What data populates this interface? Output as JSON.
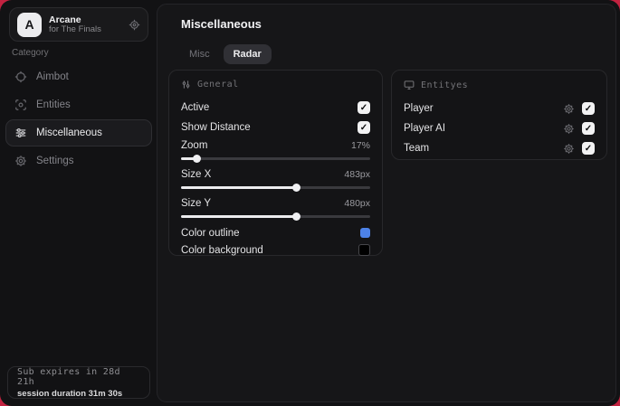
{
  "colors": {
    "accent_red_background": "#c22240",
    "window_background": "#121214",
    "checkbox": "#f2f2f3",
    "outline_swatch": "#4d82e8",
    "background_swatch": "#000000"
  },
  "icons": {
    "check": "✓",
    "profile_action": "gear-icon",
    "aimbot": "crosshair-icon",
    "entities": "scan-icon",
    "miscellaneous": "sliders-icon",
    "settings": "gear-icon",
    "general_header": "sliders-icon",
    "entities_header": "monitor-icon",
    "entity_row_action": "gear-icon"
  },
  "sidebar": {
    "logo_letter": "A",
    "app_name": "Arcane",
    "app_subtitle": "for The Finals",
    "category_label": "Category",
    "items": [
      {
        "label": "Aimbot",
        "selected": false
      },
      {
        "label": "Entities",
        "selected": false
      },
      {
        "label": "Miscellaneous",
        "selected": true
      },
      {
        "label": "Settings",
        "selected": false
      }
    ],
    "footer": {
      "sub_expires": "Sub expires in 28d 21h",
      "session_duration": "session duration 31m 30s"
    }
  },
  "main": {
    "title": "Miscellaneous",
    "tabs": [
      {
        "label": "Misc",
        "active": false
      },
      {
        "label": "Radar",
        "active": true
      }
    ],
    "general": {
      "header": "General",
      "toggles": [
        {
          "label": "Active",
          "checked": true
        },
        {
          "label": "Show Distance",
          "checked": true
        }
      ],
      "sliders": [
        {
          "label": "Zoom",
          "value": "17%",
          "fill_pct": 8
        },
        {
          "label": "Size X",
          "value": "483px",
          "fill_pct": 61
        },
        {
          "label": "Size Y",
          "value": "480px",
          "fill_pct": 61
        }
      ],
      "color_rows": [
        {
          "label": "Color outline",
          "swatch": "#4d82e8"
        },
        {
          "label": "Color background",
          "swatch": "#000000"
        }
      ]
    },
    "entities": {
      "header": "Entityes",
      "rows": [
        {
          "label": "Player",
          "checked": true
        },
        {
          "label": "Player AI",
          "checked": true
        },
        {
          "label": "Team",
          "checked": true
        }
      ]
    }
  }
}
